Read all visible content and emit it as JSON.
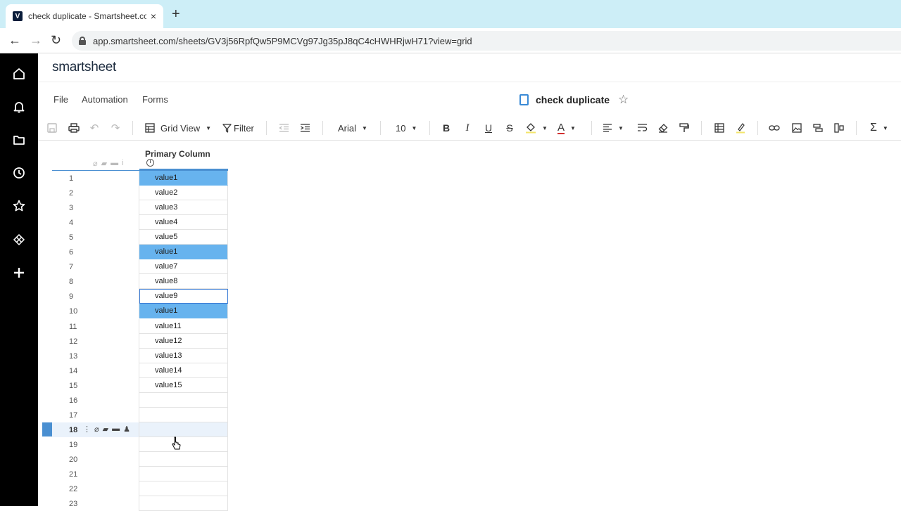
{
  "browser": {
    "tab_title": "check duplicate - Smartsheet.com",
    "tab_close": "×",
    "new_tab": "+",
    "favicon_letter": "V",
    "url": "app.smartsheet.com/sheets/GV3j56RpfQw5P9MCVg97Jg35pJ8qC4cHWHRjwH71?view=grid",
    "nav": {
      "back": "←",
      "forward": "→",
      "reload": "↻"
    }
  },
  "app": {
    "logo": "smartsheet",
    "menu": [
      "File",
      "Automation",
      "Forms"
    ],
    "sheet_title": "check duplicate",
    "star": "☆"
  },
  "toolbar": {
    "view_label": "Grid View",
    "filter_label": "Filter",
    "font_family": "Arial",
    "font_size": "10",
    "bold": "B",
    "italic": "I",
    "underline": "U",
    "strike": "S",
    "text_color": "A",
    "sum": "Σ"
  },
  "colors": {
    "duplicate_highlight": "#67b3ee",
    "selection_outline": "#3a7bd5",
    "rail": "#000000"
  },
  "grid": {
    "column_header": "Primary Column",
    "info_glyph": "i",
    "rows": [
      {
        "num": "1",
        "value": "value1",
        "dup": true
      },
      {
        "num": "2",
        "value": "value2"
      },
      {
        "num": "3",
        "value": "value3"
      },
      {
        "num": "4",
        "value": "value4"
      },
      {
        "num": "5",
        "value": "value5"
      },
      {
        "num": "6",
        "value": "value1",
        "dup": true
      },
      {
        "num": "7",
        "value": "value7"
      },
      {
        "num": "8",
        "value": "value8"
      },
      {
        "num": "9",
        "value": "value9",
        "selected": true
      },
      {
        "num": "10",
        "value": "value1",
        "dup": true
      },
      {
        "num": "11",
        "value": "value11"
      },
      {
        "num": "12",
        "value": "value12"
      },
      {
        "num": "13",
        "value": "value13"
      },
      {
        "num": "14",
        "value": "value14"
      },
      {
        "num": "15",
        "value": "value15"
      },
      {
        "num": "16",
        "value": ""
      },
      {
        "num": "17",
        "value": ""
      },
      {
        "num": "18",
        "value": "",
        "active": true
      },
      {
        "num": "19",
        "value": ""
      },
      {
        "num": "20",
        "value": ""
      },
      {
        "num": "21",
        "value": ""
      },
      {
        "num": "22",
        "value": ""
      },
      {
        "num": "23",
        "value": ""
      }
    ]
  }
}
